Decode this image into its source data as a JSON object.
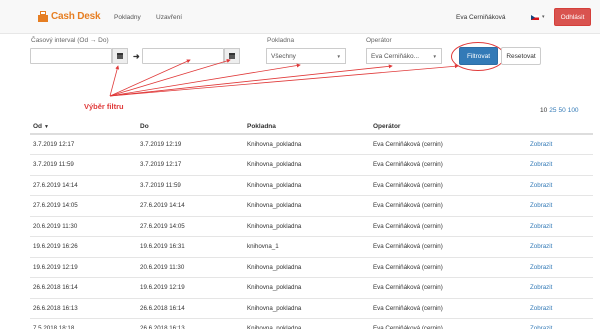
{
  "navbar": {
    "brand": "Cash Desk",
    "links": [
      "Pokladny",
      "Uzavření"
    ],
    "user": "Eva Cerniňáková",
    "logout_label": "Odhlásit",
    "colors": {
      "brand": "#e67e22",
      "logout": "#d9534f"
    }
  },
  "filters": {
    "date_label": "Časový interval (Od → Do)",
    "date_from_value": "",
    "date_to_value": "",
    "pokladna_label": "Pokladna",
    "pokladna_value": "Všechny",
    "operator_label": "Operátor",
    "operator_value": "Eva Cerniňáko...",
    "filter_button": "Filtrovat",
    "reset_button": "Resetovat"
  },
  "annotation": {
    "label": "Výběr filtru",
    "color": "#e03a3a"
  },
  "pagination": {
    "page_sizes": [
      "10",
      "25",
      "50",
      "100"
    ],
    "selected": "10"
  },
  "table": {
    "headers": [
      "Od",
      "Do",
      "Pokladna",
      "Operátor",
      ""
    ],
    "rows": [
      [
        "3.7.2019 12:17",
        "3.7.2019 12:19",
        "Knihovna_pokladna",
        "Eva Cerniňáková (cernin)",
        "Zobrazit"
      ],
      [
        "3.7.2019 11:59",
        "3.7.2019 12:17",
        "Knihovna_pokladna",
        "Eva Cerniňáková (cernin)",
        "Zobrazit"
      ],
      [
        "27.6.2019 14:14",
        "3.7.2019 11:59",
        "Knihovna_pokladna",
        "Eva Cerniňáková (cernin)",
        "Zobrazit"
      ],
      [
        "27.6.2019 14:05",
        "27.6.2019 14:14",
        "Knihovna_pokladna",
        "Eva Cerniňáková (cernin)",
        "Zobrazit"
      ],
      [
        "20.6.2019 11:30",
        "27.6.2019 14:05",
        "Knihovna_pokladna",
        "Eva Cerniňáková (cernin)",
        "Zobrazit"
      ],
      [
        "19.6.2019 16:26",
        "19.6.2019 16:31",
        "knihovna_1",
        "Eva Cerniňáková (cernin)",
        "Zobrazit"
      ],
      [
        "19.6.2019 12:19",
        "20.6.2019 11:30",
        "Knihovna_pokladna",
        "Eva Cerniňáková (cernin)",
        "Zobrazit"
      ],
      [
        "26.6.2018 16:14",
        "19.6.2019 12:19",
        "Knihovna_pokladna",
        "Eva Cerniňáková (cernin)",
        "Zobrazit"
      ],
      [
        "26.6.2018 16:13",
        "26.6.2018 16:14",
        "Knihovna_pokladna",
        "Eva Cerniňáková (cernin)",
        "Zobrazit"
      ],
      [
        "7.5.2018 18:18",
        "26.6.2018 16:13",
        "Knihovna_pokladna",
        "Eva Cerniňáková (cernin)",
        "Zobrazit"
      ]
    ]
  }
}
